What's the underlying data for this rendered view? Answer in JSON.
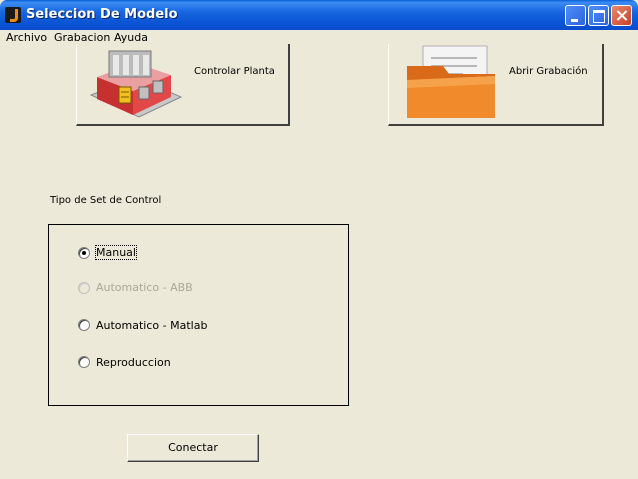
{
  "window": {
    "title": "Seleccion De Modelo"
  },
  "menu": {
    "items": [
      "Archivo",
      "Grabacion",
      "Ayuda"
    ]
  },
  "toolbar": {
    "control_plant_label": "Controlar Planta",
    "open_recording_label": "Abrir Grabación"
  },
  "control_group": {
    "title": "Tipo de Set de Control",
    "options": [
      {
        "label": "Manual",
        "checked": true,
        "enabled": true
      },
      {
        "label": "Automatico - ABB",
        "checked": false,
        "enabled": false
      },
      {
        "label": "Automatico - Matlab",
        "checked": false,
        "enabled": true
      },
      {
        "label": "Reproduccion",
        "checked": false,
        "enabled": true
      }
    ]
  },
  "connect_button": {
    "label": "Conectar"
  }
}
